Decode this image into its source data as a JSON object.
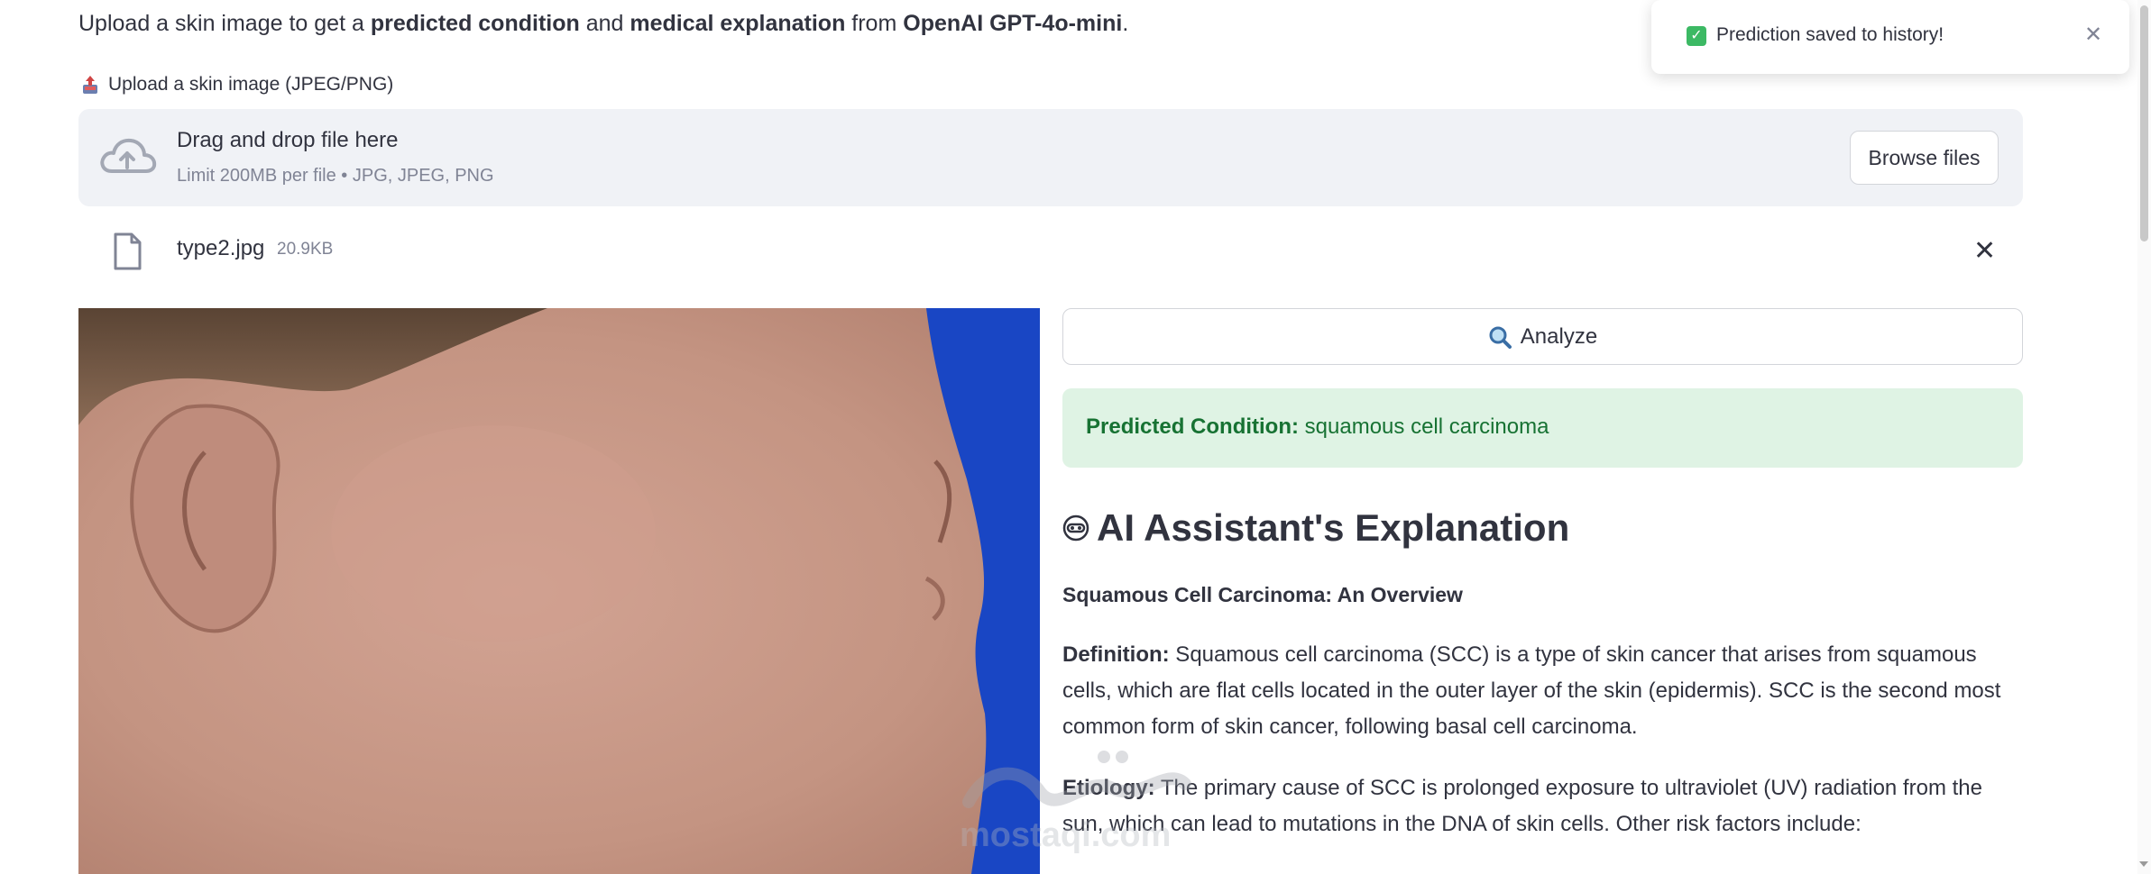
{
  "intro": {
    "prefix": "Upload a skin image to get a ",
    "bold1": "predicted condition",
    "mid": " and ",
    "bold2": "medical explanation",
    "mid2": " from ",
    "bold3": "OpenAI GPT-4o-mini",
    "suffix": "."
  },
  "uploader": {
    "label": "Upload a skin image (JPEG/PNG)",
    "drag_text": "Drag and drop file here",
    "limit_text": "Limit 200MB per file • JPG, JPEG, PNG",
    "browse_label": "Browse files",
    "file_name": "type2.jpg",
    "file_size": "20.9KB"
  },
  "analyze_label": "Analyze",
  "prediction": {
    "label": "Predicted Condition:",
    "value": "squamous cell carcinoma"
  },
  "explanation": {
    "heading": "AI Assistant's Explanation",
    "subheading": "Squamous Cell Carcinoma: An Overview",
    "def_label": "Definition:",
    "def_text": " Squamous cell carcinoma (SCC) is a type of skin cancer that arises from squamous cells, which are flat cells located in the outer layer of the skin (epidermis). SCC is the second most common form of skin cancer, following basal cell carcinoma.",
    "etio_label": "Etiology:",
    "etio_text": " The primary cause of SCC is prolonged exposure to ultraviolet (UV) radiation from the sun, which can lead to mutations in the DNA of skin cells. Other risk factors include:"
  },
  "toast": {
    "message": "Prediction saved to history!"
  },
  "watermark": {
    "text": "mostaqi.com"
  },
  "colors": {
    "success_bg": "#dff3e4",
    "success_text": "#177233",
    "dropzone_bg": "#f0f2f6",
    "photo_blue": "#1946c4"
  }
}
